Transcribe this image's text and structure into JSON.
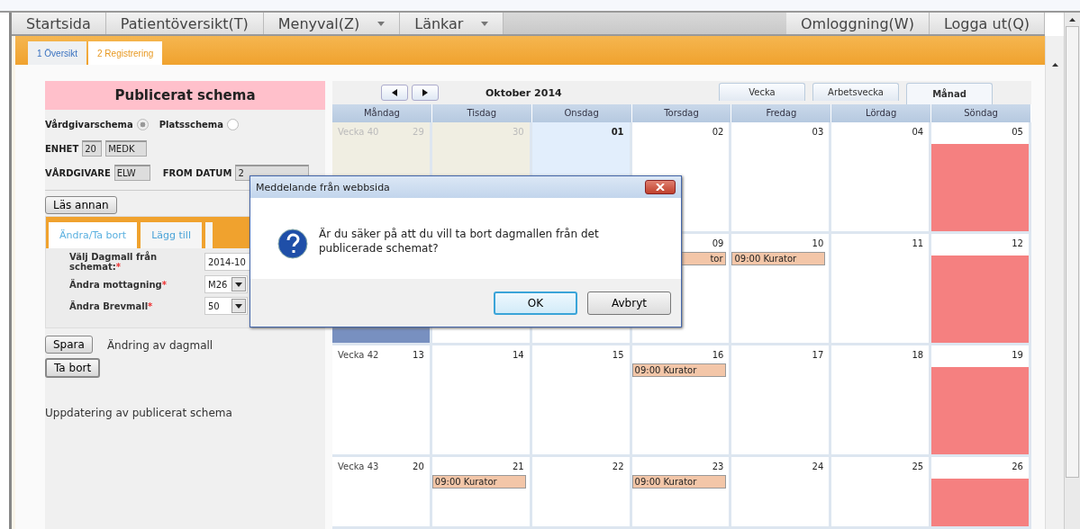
{
  "menu_bar": {
    "left": [
      {
        "label": "Startsida",
        "dropdown": false
      },
      {
        "label": "Patientöversikt(T)",
        "dropdown": false
      },
      {
        "label": "Menyval(Z)",
        "dropdown": true
      },
      {
        "label": "Länkar",
        "dropdown": true
      }
    ],
    "right": [
      {
        "label": "Omloggning(W)"
      },
      {
        "label": "Logga ut(Q)"
      }
    ]
  },
  "page_tabs": [
    {
      "label": "1 Översikt",
      "selected": false
    },
    {
      "label": "2 Registrering",
      "selected": true
    }
  ],
  "panel": {
    "title": "Publicerat schema",
    "schedule_type": [
      {
        "label": "Vårdgivarschema",
        "selected": true
      },
      {
        "label": "Platsschema",
        "selected": false
      }
    ],
    "enhet": {
      "label": "ENHET",
      "code": "20",
      "name": "MEDK"
    },
    "vardgivare": {
      "label": "VÅRDGIVARE",
      "value": "ELW"
    },
    "from_datum": {
      "label": "FROM DATUM",
      "value": "2"
    },
    "read_button": "Läs annan",
    "sub_tabs": [
      {
        "label": "Ändra/Ta bort",
        "selected": true
      },
      {
        "label": "Lägg till",
        "selected": false
      }
    ],
    "form": [
      {
        "label": "Välj Dagmall från schemat:",
        "mark": "*",
        "kind": "text",
        "value": "2014-10"
      },
      {
        "label": "Ändra mottagning",
        "mark": "*",
        "kind": "select",
        "value": "M26"
      },
      {
        "label": "Ändra Brevmall",
        "mark": "*",
        "kind": "select",
        "value": "50"
      }
    ],
    "save_button": "Spara",
    "save_note": "Ändring av dagmall",
    "delete_button": "Ta bort",
    "footer_note": "Uppdatering av publicerat schema"
  },
  "calendar": {
    "title": "Oktober 2014",
    "view_tabs": [
      {
        "label": "Vecka",
        "selected": false
      },
      {
        "label": "Arbetsvecka",
        "selected": false
      },
      {
        "label": "Månad",
        "selected": true
      }
    ],
    "days_of_week": [
      "Måndag",
      "Tisdag",
      "Onsdag",
      "Torsdag",
      "Fredag",
      "Lördag",
      "Söndag"
    ],
    "weeks": [
      {
        "label": "Vecka 40",
        "days": [
          {
            "number": "29",
            "kind": "other"
          },
          {
            "number": "30",
            "kind": "other"
          },
          {
            "number": "01",
            "kind": "today"
          },
          {
            "number": "02",
            "kind": "normal"
          },
          {
            "number": "03",
            "kind": "normal"
          },
          {
            "number": "04",
            "kind": "normal"
          },
          {
            "number": "05",
            "kind": "holiday"
          }
        ]
      },
      {
        "days": [
          {
            "kind": "selected"
          },
          {
            "kind": "normal"
          },
          {
            "kind": "normal"
          },
          {
            "number": "09",
            "kind": "normal",
            "events": [
              {
                "text": "tor",
                "cut": true
              }
            ]
          },
          {
            "number": "10",
            "kind": "normal",
            "events": [
              {
                "text": "09:00 Kurator",
                "cut": false
              }
            ]
          },
          {
            "number": "11",
            "kind": "normal"
          },
          {
            "number": "12",
            "kind": "holiday"
          }
        ]
      },
      {
        "label": "Vecka 42",
        "days": [
          {
            "number": "13",
            "kind": "normal"
          },
          {
            "number": "14",
            "kind": "normal"
          },
          {
            "number": "15",
            "kind": "normal"
          },
          {
            "number": "16",
            "kind": "normal",
            "events": [
              {
                "text": "09:00 Kurator",
                "cut": false
              }
            ]
          },
          {
            "number": "17",
            "kind": "normal"
          },
          {
            "number": "18",
            "kind": "normal"
          },
          {
            "number": "19",
            "kind": "holiday"
          }
        ]
      },
      {
        "label": "Vecka 43",
        "days": [
          {
            "number": "20",
            "kind": "normal"
          },
          {
            "number": "21",
            "kind": "normal",
            "events": [
              {
                "text": "09:00 Kurator",
                "cut": false
              }
            ]
          },
          {
            "number": "22",
            "kind": "normal"
          },
          {
            "number": "23",
            "kind": "normal",
            "events": [
              {
                "text": "09:00 Kurator",
                "cut": false
              }
            ]
          },
          {
            "number": "24",
            "kind": "normal"
          },
          {
            "number": "25",
            "kind": "normal"
          },
          {
            "number": "26",
            "kind": "holiday"
          }
        ]
      }
    ]
  },
  "dialog": {
    "title": "Meddelande från webbsida",
    "message": "Är du säker på att du vill ta bort dagmallen från det publicerade schemat?",
    "buttons": [
      {
        "label": "OK",
        "default": true
      },
      {
        "label": "Avbryt",
        "default": false
      }
    ]
  }
}
